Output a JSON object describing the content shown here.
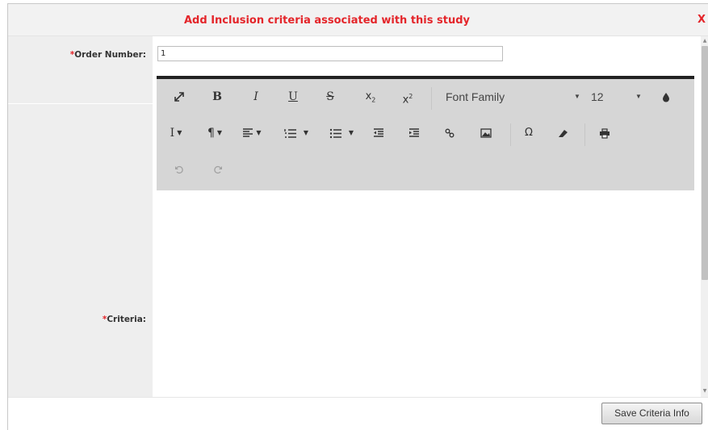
{
  "dialog": {
    "title": "Add Inclusion criteria associated with this study",
    "close_label": "X"
  },
  "form": {
    "order_number": {
      "required_mark": "*",
      "label": "Order Number:",
      "value": "1"
    },
    "criteria": {
      "required_mark": "*",
      "label": "Criteria:"
    }
  },
  "toolbar": {
    "row1": {
      "bold": "B",
      "italic": "I",
      "underline": "U",
      "strike": "S",
      "subscript": "x",
      "subscript_sub": "2",
      "superscript": "x",
      "superscript_sup": "2",
      "font_family": "Font Family",
      "font_size": "12"
    },
    "icons": {
      "fullscreen": "expand-icon",
      "color": "drop-icon",
      "line_height": "line-height-icon",
      "paragraph": "pilcrow-icon",
      "align": "align-icon",
      "ordered_list": "ordered-list-icon",
      "unordered_list": "unordered-list-icon",
      "outdent": "outdent-icon",
      "indent": "indent-icon",
      "link": "link-icon",
      "image": "image-icon",
      "special_char": "omega-icon",
      "clear_format": "eraser-icon",
      "print": "print-icon",
      "undo": "undo-icon",
      "redo": "redo-icon"
    },
    "glyphs": {
      "line_height": "I",
      "paragraph": "¶",
      "omega": "Ω"
    }
  },
  "footer": {
    "save_label": "Save Criteria Info"
  },
  "colors": {
    "accent_red": "#e4252a",
    "toolbar_bg": "#d6d6d6",
    "editor_border": "#222222"
  }
}
